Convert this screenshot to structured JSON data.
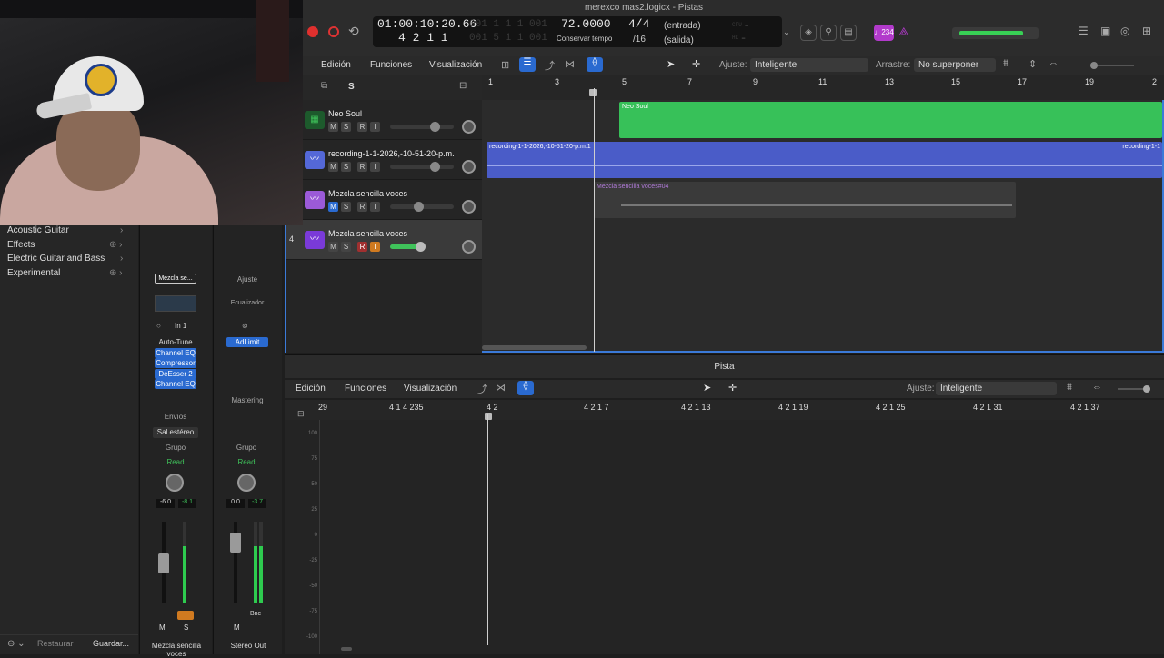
{
  "window": {
    "title": "merexco mas2.logicx - Pistas"
  },
  "transport": {
    "position_time": "01:00:10:20.66",
    "position_bars": "4  2  1       1",
    "dim_row1": "001  1  1  1  001",
    "dim_row2": "001  5  1  1  001",
    "tempo": "72.0000",
    "tempo_label": "Conservar tempo",
    "time_sig": "4/4",
    "division": "/16",
    "input_label": "(entrada)",
    "output_label": "(salida)",
    "count_in_label": "♩234",
    "colors": {
      "record": "#e0302e",
      "meter": "#38d055"
    }
  },
  "tracks_toolbar": {
    "edit": "Edición",
    "functions": "Funciones",
    "view": "Visualización",
    "snap_label": "Ajuste:",
    "snap_value": "Inteligente",
    "drag_label": "Arrastre:",
    "drag_value": "No superponer",
    "s_button": "S"
  },
  "ruler": {
    "bars": [
      "1",
      "3",
      "5",
      "7",
      "9",
      "11",
      "13",
      "15",
      "17",
      "19",
      "2"
    ]
  },
  "tracks": [
    {
      "number": "",
      "name": "Neo Soul",
      "m": "M",
      "s": "S",
      "r": "R",
      "i": "I",
      "icon": "drum-machine-icon",
      "color": "#3fc25a"
    },
    {
      "number": "",
      "name": "recording-1-1-2026,-10-51-20-p.m.",
      "m": "M",
      "s": "S",
      "r": "R",
      "i": "I",
      "icon": "waveform-icon",
      "color": "#5468d8"
    },
    {
      "number": "",
      "name": "Mezcla sencilla voces",
      "m": "M",
      "s": "S",
      "r": "R",
      "i": "I",
      "icon": "waveform-icon",
      "color": "#9b5ad8"
    },
    {
      "number": "4",
      "name": "Mezcla sencilla voces",
      "m": "M",
      "s": "S",
      "r": "R",
      "i": "I",
      "icon": "waveform-icon",
      "color": "#9b5ad8"
    }
  ],
  "regions": {
    "neo_soul": "Neo Soul",
    "recording": "recording-1-1-2026,-10-51-20-p.m.1",
    "recording_end": "recording-1-1",
    "voces": "Mezcla sencilla voces#04"
  },
  "library": {
    "items": [
      "Acoustic Guitar",
      "Effects",
      "Electric Guitar and Bass",
      "Experimental"
    ],
    "restore": "Restaurar",
    "save": "Guardar..."
  },
  "strip1": {
    "setting": "Mezcla se...",
    "input": "In 1",
    "plugins": [
      "Auto-Tune",
      "Channel EQ",
      "Compressor",
      "DeEsser 2",
      "Channel EQ"
    ],
    "sends": "Envíos",
    "output": "Sal estéreo",
    "group": "Grupo",
    "automation": "Read",
    "pan_value": "-6.0",
    "peak_value": "-8.1",
    "m": "M",
    "s": "S",
    "name": "Mezcla sencilla voces"
  },
  "strip2": {
    "setting": "Ajuste",
    "eq_label": "Ecualizador",
    "plugins": [
      "AdLimit"
    ],
    "mastering": "Mastering",
    "group": "Grupo",
    "automation": "Read",
    "pan_value": "0.0",
    "peak_value": "-3.7",
    "m": "M",
    "bnc": "Bnc",
    "name": "Stereo Out"
  },
  "editor": {
    "title": "Pista",
    "edit": "Edición",
    "functions": "Funciones",
    "view": "Visualización",
    "snap_label": "Ajuste:",
    "snap_value": "Inteligente",
    "ruler": [
      "29",
      "4 1 4 235",
      "4 2",
      "4 2 1 7",
      "4 2 1 13",
      "4 2 1 19",
      "4 2 1 25",
      "4 2 1 31",
      "4 2 1 37"
    ],
    "db_scale": [
      "100",
      "75",
      "50",
      "25",
      "0",
      "-25",
      "-50",
      "-75",
      "-100"
    ]
  }
}
